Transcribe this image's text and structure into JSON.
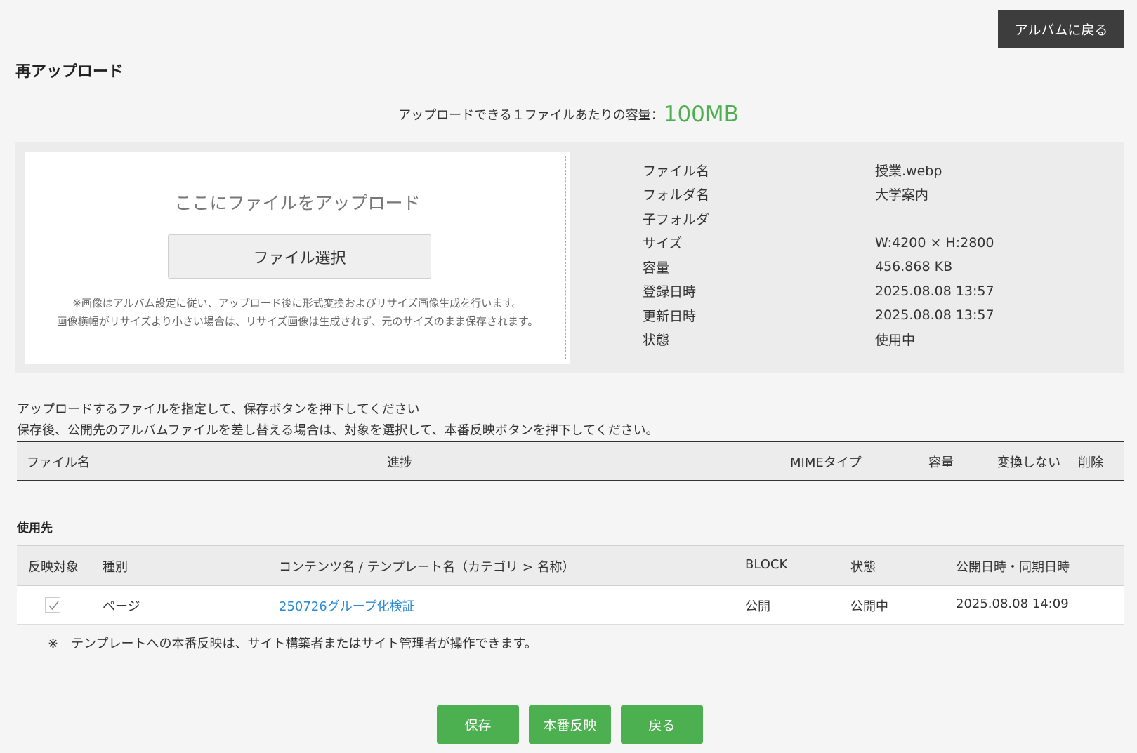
{
  "header": {
    "back_to_album_label": "アルバムに戻る",
    "page_title": "再アップロード"
  },
  "capacity": {
    "label": "アップロードできる１ファイルあたりの容量：",
    "value": "100MB"
  },
  "dropzone": {
    "text": "ここにファイルをアップロード",
    "file_select_label": "ファイル選択",
    "note_line1": "※画像はアルバム設定に従い、アップロード後に形式変換およびリサイズ画像生成を行います。",
    "note_line2": "画像横幅がリサイズより小さい場合は、リサイズ画像は生成されず、元のサイズのまま保存されます。"
  },
  "file_info": [
    {
      "label": "ファイル名",
      "value": "授業.webp"
    },
    {
      "label": "フォルダ名",
      "value": "大学案内"
    },
    {
      "label": "子フォルダ",
      "value": ""
    },
    {
      "label": "サイズ",
      "value": "W:4200 × H:2800"
    },
    {
      "label": "容量",
      "value": "456.868 KB"
    },
    {
      "label": "登録日時",
      "value": "2025.08.08 13:57"
    },
    {
      "label": "更新日時",
      "value": "2025.08.08 13:57"
    },
    {
      "label": "状態",
      "value": "使用中"
    }
  ],
  "instructions": {
    "line1": "アップロードするファイルを指定して、保存ボタンを押下してください",
    "line2": "保存後、公開先のアルバムファイルを差し替える場合は、対象を選択して、本番反映ボタンを押下してください。"
  },
  "file_table": {
    "headers": [
      "ファイル名",
      "進捗",
      "MIMEタイプ",
      "容量",
      "変換しない",
      "削除"
    ]
  },
  "usage": {
    "title": "使用先",
    "headers": [
      "反映対象",
      "種別",
      "コンテンツ名 / テンプレート名（カテゴリ > 名称）",
      "BLOCK",
      "状態",
      "公開日時・同期日時"
    ],
    "rows": [
      {
        "type": "ページ",
        "content": "250726グループ化検証",
        "block": "公開",
        "status": "公開中",
        "date": "2025.08.08 14:09"
      }
    ],
    "note": "※　テンプレートへの本番反映は、サイト構築者またはサイト管理者が操作できます。"
  },
  "footer": {
    "save_label": "保存",
    "publish_label": "本番反映",
    "back_label": "戻る"
  }
}
